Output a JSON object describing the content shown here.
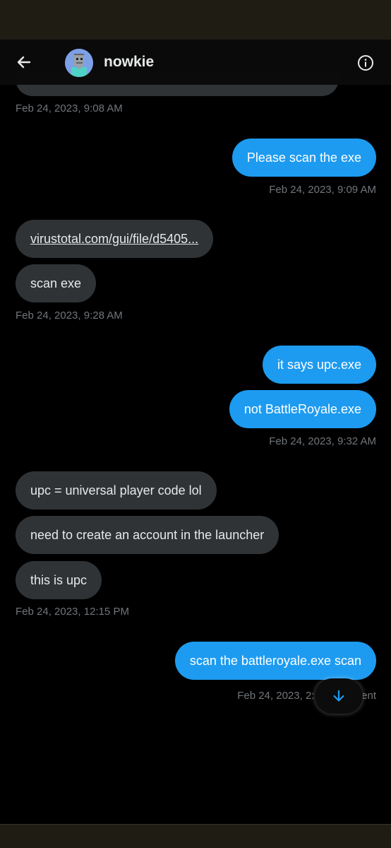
{
  "header": {
    "contact_name": "nowkie",
    "back_icon": "arrow-left-icon",
    "info_icon": "info-circle-icon"
  },
  "messages": [
    {
      "ts": "Feb 24, 2023, 9:08 AM"
    },
    {
      "text": "Please scan the exe",
      "ts": "Feb 24, 2023, 9:09 AM"
    },
    {
      "link": "virustotal.com/gui/file/d5405...",
      "text": "scan exe",
      "ts": "Feb 24, 2023, 9:28 AM"
    },
    {
      "text1": "it says upc.exe",
      "text2": "not BattleRoyale.exe",
      "ts": "Feb 24, 2023, 9:32 AM"
    },
    {
      "text1": "upc = universal player code lol",
      "text2": "need to create an account in the launcher",
      "text3": "this is upc",
      "ts": "Feb 24, 2023, 12:15 PM"
    },
    {
      "text": "scan the battleroyale.exe scan",
      "ts": "Feb 24, 2023, 2:40 PM · Sent"
    }
  ],
  "colors": {
    "outgoing_bubble": "#1d9bf0",
    "incoming_bubble": "#2f3336",
    "timestamp": "#71767b",
    "background": "#000000"
  },
  "scroll_button": {
    "icon": "arrow-down-icon"
  }
}
